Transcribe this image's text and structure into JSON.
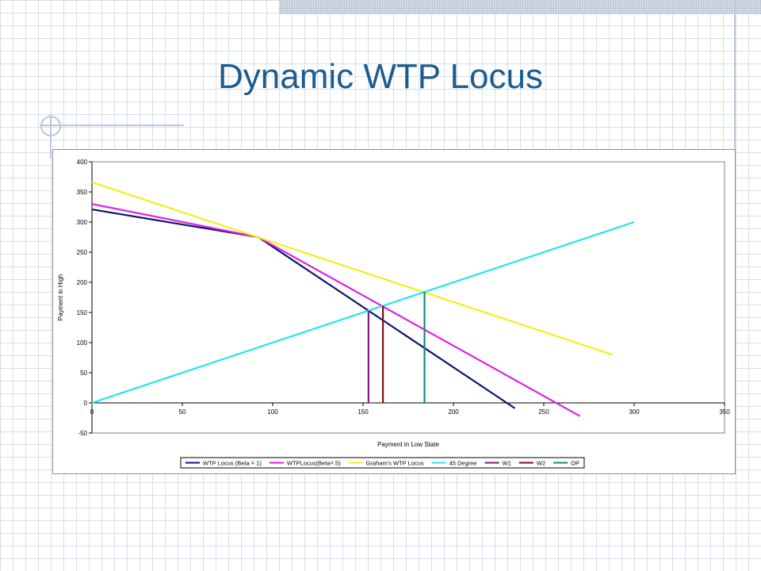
{
  "slide": {
    "title": "Dynamic WTP Locus"
  },
  "colors": {
    "title": "#1c5c8e",
    "decor": "#b9c8da"
  },
  "chart_data": {
    "type": "line",
    "title": "",
    "xlabel": "Payment in Low State",
    "ylabel": "Payment in High",
    "xlim": [
      0,
      350
    ],
    "ylim": [
      -50,
      400
    ],
    "xticks": [
      0,
      50,
      100,
      150,
      200,
      250,
      300,
      350
    ],
    "yticks": [
      -50,
      0,
      50,
      100,
      150,
      200,
      250,
      300,
      350,
      400
    ],
    "grid": false,
    "legend_position": "bottom",
    "series": [
      {
        "name": "WTP Locus (Beta = 1)",
        "color": "#0a1a6e",
        "points": [
          [
            0,
            321
          ],
          [
            92,
            275
          ],
          [
            234,
            -9
          ]
        ]
      },
      {
        "name": "WTPLocus(Beta=.5)",
        "color": "#e020e0",
        "points": [
          [
            0,
            330
          ],
          [
            92,
            275
          ],
          [
            270,
            -22
          ]
        ]
      },
      {
        "name": "Graham's WTP Locus",
        "color": "#f2ee1c",
        "points": [
          [
            0,
            366
          ],
          [
            288,
            80
          ]
        ]
      },
      {
        "name": "45 Degree",
        "color": "#22e6ee",
        "points": [
          [
            0,
            0
          ],
          [
            300,
            300
          ]
        ]
      },
      {
        "name": "W1",
        "color": "#7a1a82",
        "points": [
          [
            153,
            0
          ],
          [
            153,
            153
          ]
        ]
      },
      {
        "name": "W2",
        "color": "#7a1214",
        "points": [
          [
            161,
            0
          ],
          [
            161,
            161
          ]
        ]
      },
      {
        "name": "OP",
        "color": "#138a88",
        "points": [
          [
            184,
            0
          ],
          [
            184,
            184
          ]
        ]
      }
    ]
  }
}
